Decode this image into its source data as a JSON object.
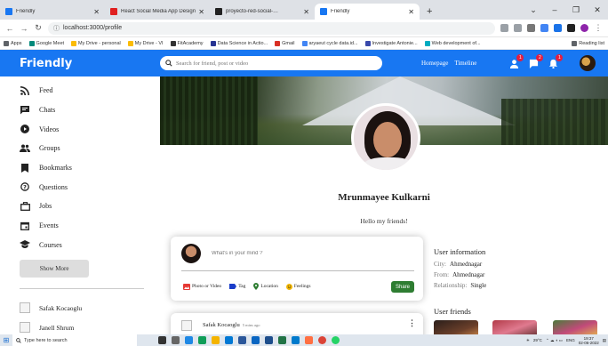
{
  "browser": {
    "tabs": [
      {
        "title": "Friendly",
        "color": "#1877f2",
        "active": false
      },
      {
        "title": "React Social Media App Design Tut",
        "color": "#e02020",
        "active": false
      },
      {
        "title": "proyecto-red-social-…",
        "color": "#222222",
        "active": false
      },
      {
        "title": "Friendly",
        "color": "#1877f2",
        "active": true
      }
    ],
    "url": "localhost:3000/profile",
    "bookmarks": [
      "Apps",
      "Google Meet",
      "My Drive - personal",
      "My Drive - VI",
      "FitAcademy",
      "Data Science in Actio...",
      "Gmail",
      "aryaeut cycle data.id...",
      "Investigate Antonie...",
      "Web development of..."
    ],
    "reading_list": "Reading list"
  },
  "app": {
    "logo": "Friendly",
    "search_placeholder": "Search for friend, post or video",
    "nav_links": [
      "Homepage",
      "Timeline"
    ],
    "notifications": [
      {
        "icon": "person-icon",
        "count": "1"
      },
      {
        "icon": "chat-icon",
        "count": "2"
      },
      {
        "icon": "bell-icon",
        "count": "1"
      }
    ]
  },
  "sidebar": {
    "items": [
      {
        "label": "Feed",
        "icon": "rss-icon"
      },
      {
        "label": "Chats",
        "icon": "chat-icon"
      },
      {
        "label": "Videos",
        "icon": "play-circle-icon"
      },
      {
        "label": "Groups",
        "icon": "group-icon"
      },
      {
        "label": "Bookmarks",
        "icon": "bookmark-icon"
      },
      {
        "label": "Questions",
        "icon": "help-circle-icon"
      },
      {
        "label": "Jobs",
        "icon": "briefcase-icon"
      },
      {
        "label": "Events",
        "icon": "event-icon"
      },
      {
        "label": "Courses",
        "icon": "school-icon"
      }
    ],
    "show_more": "Show More",
    "friends": [
      "Safak Kocaoglu",
      "Janell Shrum"
    ]
  },
  "profile": {
    "name": "Mrunmayee Kulkarni",
    "description": "Hello my friends!"
  },
  "share": {
    "placeholder": "What's in your mind ?",
    "options": [
      {
        "label": "Photo or Video",
        "color": "#e53935"
      },
      {
        "label": "Tag",
        "color": "#1a3dc9"
      },
      {
        "label": "Location",
        "color": "#2e7d32"
      },
      {
        "label": "Feelings",
        "color": "#f2b705"
      }
    ],
    "button": "Share"
  },
  "post": {
    "username": "Safak Kocaoglu",
    "time": "5 mins ago"
  },
  "user_info": {
    "title": "User information",
    "rows": [
      {
        "key": "City:",
        "value": "Ahmednagar"
      },
      {
        "key": "From:",
        "value": "Ahmednagar"
      },
      {
        "key": "Relationship:",
        "value": "Single"
      }
    ],
    "friends_title": "User friends"
  },
  "taskbar": {
    "search_placeholder": "Type here to search",
    "weather": "29°C",
    "lang": "ENG",
    "time": "19:37",
    "date": "02-06-2022"
  }
}
